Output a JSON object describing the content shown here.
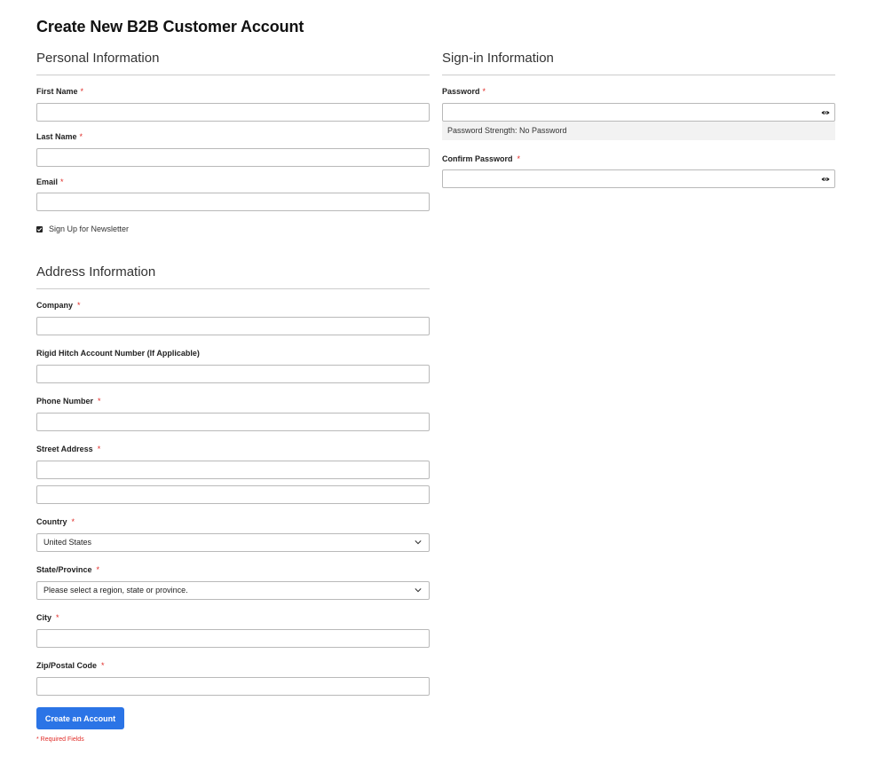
{
  "page": {
    "title": "Create New B2B Customer Account"
  },
  "personal": {
    "section_title": "Personal Information",
    "first_name": {
      "label": "First Name",
      "required": "*",
      "value": ""
    },
    "last_name": {
      "label": "Last Name",
      "required": "*",
      "value": ""
    },
    "email": {
      "label": "Email",
      "required": "*",
      "value": ""
    },
    "newsletter": {
      "label": "Sign Up for Newsletter",
      "checked": true
    }
  },
  "signin": {
    "section_title": "Sign-in Information",
    "password": {
      "label": "Password",
      "required": "*",
      "value": ""
    },
    "strength_text": "Password Strength: No Password",
    "confirm_password": {
      "label": "Confirm Password",
      "required": "*",
      "value": ""
    }
  },
  "address": {
    "section_title": "Address Information",
    "company": {
      "label": "Company",
      "required": "*",
      "value": ""
    },
    "account_number": {
      "label": "Rigid Hitch Account Number (If Applicable)",
      "value": ""
    },
    "phone": {
      "label": "Phone Number",
      "required": "*",
      "value": ""
    },
    "street": {
      "label": "Street Address",
      "required": "*",
      "line1": "",
      "line2": ""
    },
    "country": {
      "label": "Country",
      "required": "*",
      "selected": "United States"
    },
    "state": {
      "label": "State/Province",
      "required": "*",
      "selected": "Please select a region, state or province."
    },
    "city": {
      "label": "City",
      "required": "*",
      "value": ""
    },
    "zip": {
      "label": "Zip/Postal Code",
      "required": "*",
      "value": ""
    }
  },
  "actions": {
    "submit_label": "Create an Account",
    "required_note": "* Required Fields"
  },
  "colors": {
    "button": "#2b74e6",
    "required": "#e02b27"
  }
}
